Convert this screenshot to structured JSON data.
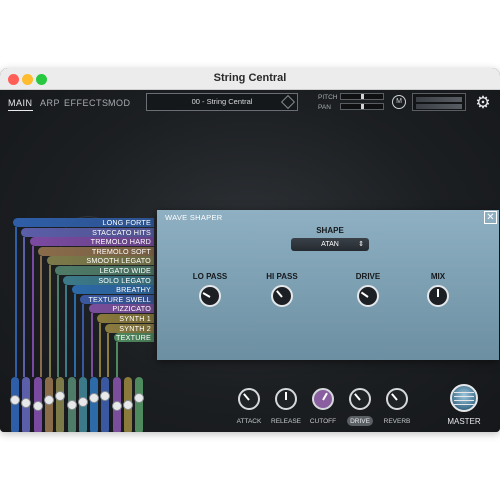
{
  "window": {
    "title": "String Central"
  },
  "nav": {
    "tabs": [
      "MAIN",
      "ARP",
      "EFFECTS",
      "MOD"
    ],
    "active": "MAIN"
  },
  "preset": {
    "name": "00 - String Central"
  },
  "controls": {
    "pitch_label": "PITCH",
    "pan_label": "PAN",
    "m_label": "M"
  },
  "articulations": [
    {
      "label": "LONG FORTE",
      "color": "#2f5ea8"
    },
    {
      "label": "STACCATO HITS",
      "color": "#5b5ea8"
    },
    {
      "label": "TREMOLO HARD",
      "color": "#7a4aa0"
    },
    {
      "label": "TREMOLO SOFT",
      "color": "#8a6c4a"
    },
    {
      "label": "SMOOTH LEGATO",
      "color": "#7d7a4a"
    },
    {
      "label": "LEGATO WIDE",
      "color": "#4f7c68"
    },
    {
      "label": "SOLO LEGATO",
      "color": "#3c7a8a"
    },
    {
      "label": "BREATHY",
      "color": "#2d6aa8"
    },
    {
      "label": "TEXTURE SWELL",
      "color": "#3a58a0"
    },
    {
      "label": "PIZZICATO",
      "color": "#7a4e9c"
    },
    {
      "label": "SYNTH 1",
      "color": "#8a7a3c"
    },
    {
      "label": "SYNTH 2",
      "color": "#8c7c40"
    },
    {
      "label": "TEXTURE",
      "color": "#4f8a5e"
    }
  ],
  "faders": {
    "colors": [
      "#2f5ea8",
      "#5b5ea8",
      "#7a4aa0",
      "#8a6c4a",
      "#7d7a4a",
      "#4f7c68",
      "#3c7a8a",
      "#2d6aa8",
      "#3a58a0",
      "#7a4e9c",
      "#8a7a3c",
      "#4f8a5e"
    ],
    "levels": [
      0.62,
      0.55,
      0.5,
      0.62,
      0.7,
      0.52,
      0.58,
      0.66,
      0.7,
      0.48,
      0.52,
      0.65
    ]
  },
  "wave_shaper": {
    "title": "WAVE SHAPER",
    "close": "✕",
    "shape_label": "SHAPE",
    "shape_value": "ATAN",
    "shape_arrows": "⇕",
    "knobs": [
      {
        "label": "LO PASS",
        "angle_deg": 210
      },
      {
        "label": "HI PASS",
        "angle_deg": 230
      },
      {
        "label": "DRIVE",
        "angle_deg": 215
      },
      {
        "label": "MIX",
        "angle_deg": 270
      }
    ]
  },
  "fx": {
    "knobs": [
      {
        "label": "ATTACK",
        "angle_deg": 230
      },
      {
        "label": "RELEASE",
        "angle_deg": 270
      },
      {
        "label": "CUTOFF",
        "angle_deg": 300
      },
      {
        "label": "DRIVE",
        "angle_deg": 230
      },
      {
        "label": "REVERB",
        "angle_deg": 230
      }
    ],
    "active": "DRIVE",
    "cutoff_color": "#8a5fa0"
  },
  "master": {
    "label": "MASTER"
  }
}
